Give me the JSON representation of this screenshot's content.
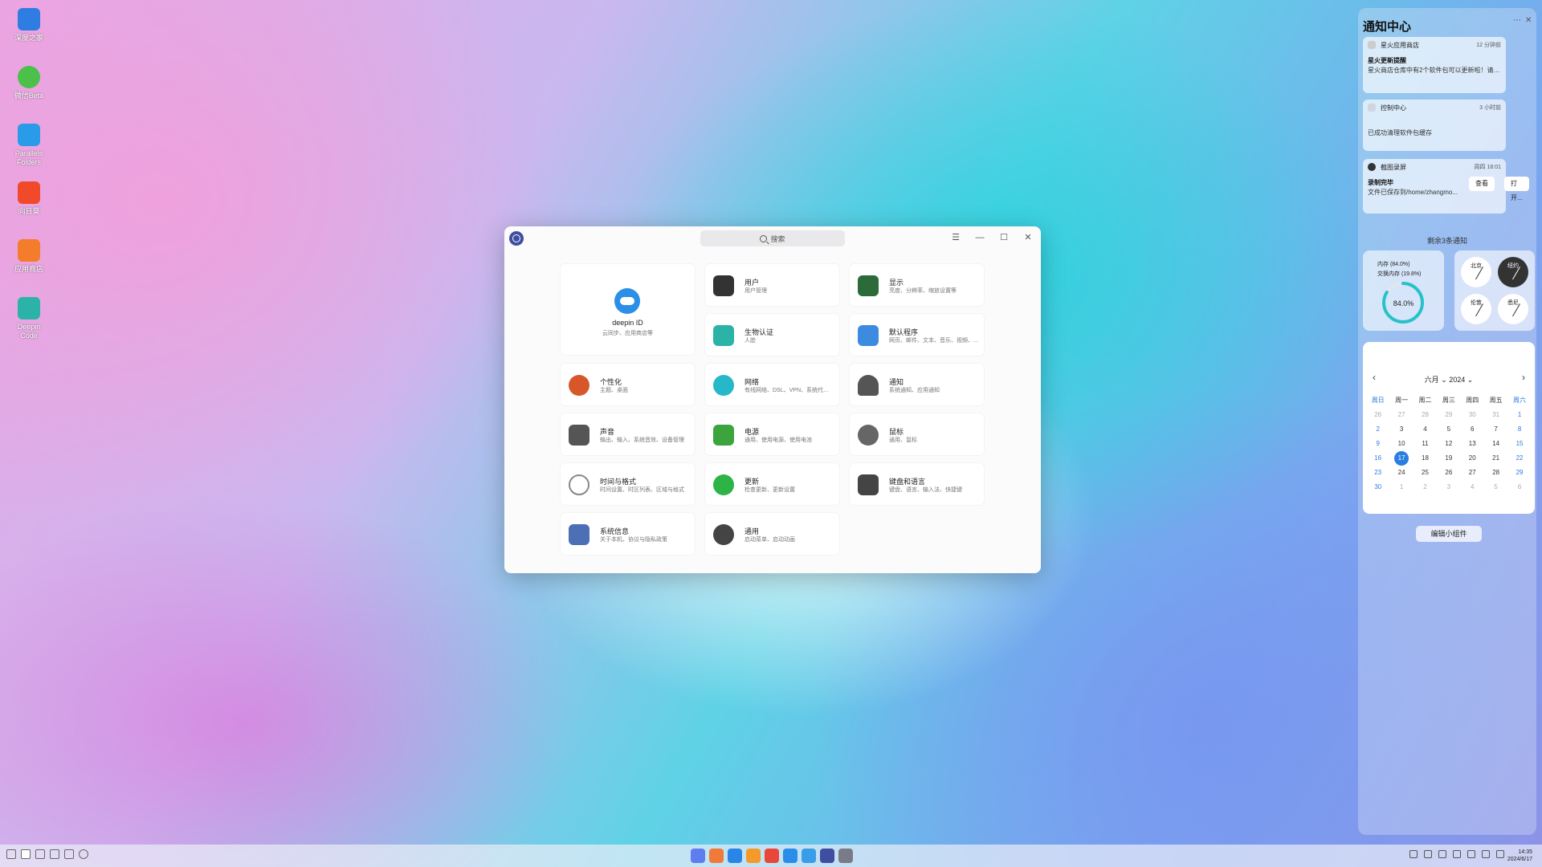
{
  "desktop_icons": [
    {
      "label": "深度之家",
      "icon": "chat-icon",
      "color": "#2f7de1"
    },
    {
      "label": "微信Beta",
      "icon": "wechat-icon",
      "color": "#4bc04a"
    },
    {
      "label": "Parallels Folders",
      "icon": "folder-icon",
      "color": "#2a9be8"
    },
    {
      "label": "向日葵",
      "icon": "sunflower-icon",
      "color": "#f04a2a"
    },
    {
      "label": "应用商店",
      "icon": "store-icon",
      "color": "#f37d2a"
    },
    {
      "label": "Deepin Code",
      "icon": "code-icon",
      "color": "#2bb3a8"
    }
  ],
  "window": {
    "search_placeholder": "搜索",
    "deepin_id": {
      "title": "deepin ID",
      "sub": "云同步、应用商店等"
    },
    "cards": [
      {
        "title": "用户",
        "sub": "用户管理",
        "color": "#333333"
      },
      {
        "title": "显示",
        "sub": "亮度、分辨率、缩放设置等",
        "color": "#2b6b3a"
      },
      {
        "title": "生物认证",
        "sub": "人脸",
        "color": "#2bb3a8"
      },
      {
        "title": "默认程序",
        "sub": "网页、邮件、文本、音乐、视频、...",
        "color": "#3d8be0"
      },
      {
        "title": "个性化",
        "sub": "主题、桌面",
        "color": "#d8572a"
      },
      {
        "title": "网络",
        "sub": "有线网络、DSL、VPN、系统代理、...",
        "color": "#26b8c9"
      },
      {
        "title": "通知",
        "sub": "系统通知、应用通知",
        "color": "#555555"
      },
      {
        "title": "声音",
        "sub": "输出、输入、系统音效、设备管理",
        "color": "#555555"
      },
      {
        "title": "电源",
        "sub": "通用、使用电源、使用电池",
        "color": "#3ca43c"
      },
      {
        "title": "鼠标",
        "sub": "通用、鼠标",
        "color": "#666666"
      },
      {
        "title": "时间与格式",
        "sub": "时间设置、时区列表、区域与格式",
        "color": "#888888"
      },
      {
        "title": "更新",
        "sub": "检查更新、更新设置",
        "color": "#2eb347"
      },
      {
        "title": "键盘和语言",
        "sub": "键盘、语言、输入法、快捷键",
        "color": "#444444"
      },
      {
        "title": "系统信息",
        "sub": "关于本机、协议与隐私政策",
        "color": "#4d6fb5"
      },
      {
        "title": "通用",
        "sub": "启动菜单、启动动画",
        "color": "#444444"
      }
    ]
  },
  "notification_center": {
    "title": "通知中心",
    "notes": [
      {
        "app": "星火应用商店",
        "time": "12 分钟前",
        "title": "星火更新提醒",
        "body": "星火商店仓库中有2个软件包可以更新啦！请到星火..."
      },
      {
        "app": "控制中心",
        "time": "3 小时前",
        "title": "",
        "body": "已成功清理软件包缓存"
      },
      {
        "app": "截图录屏",
        "time": "周四 18:01",
        "title": "录制完毕",
        "body": "文件已保存到/home/zhangmo...",
        "btn1": "查看",
        "btn2": "打开..."
      }
    ],
    "remaining": "剩余3条通知",
    "memory": {
      "mem_label": "内存 (84.0%)",
      "swap_label": "交换内存 (19.8%)",
      "percent_text": "84.0%",
      "mem_value": 84.0,
      "swap_value": 19.8
    },
    "clocks": [
      "北京",
      "纽约",
      "伦敦",
      "悉尼"
    ],
    "calendar": {
      "month": "六月",
      "year": "2024",
      "weekdays": [
        "周日",
        "周一",
        "周二",
        "周三",
        "周四",
        "周五",
        "周六"
      ],
      "weeks": [
        [
          "26",
          "27",
          "28",
          "29",
          "30",
          "31",
          "1"
        ],
        [
          "2",
          "3",
          "4",
          "5",
          "6",
          "7",
          "8"
        ],
        [
          "9",
          "10",
          "11",
          "12",
          "13",
          "14",
          "15"
        ],
        [
          "16",
          "17",
          "18",
          "19",
          "20",
          "21",
          "22"
        ],
        [
          "23",
          "24",
          "25",
          "26",
          "27",
          "28",
          "29"
        ],
        [
          "30",
          "1",
          "2",
          "3",
          "4",
          "5",
          "6"
        ]
      ],
      "today": "17"
    },
    "edit_widgets": "编辑小组件"
  },
  "taskbar": {
    "time": "14:35",
    "date": "2024/6/17",
    "dock_colors": [
      "#5e7ef0",
      "#f07a3a",
      "#2a86e6",
      "#f39a2a",
      "#e8483a",
      "#2a8de8",
      "#3a9de8",
      "#3f4ea0",
      "#7a7a88"
    ]
  }
}
